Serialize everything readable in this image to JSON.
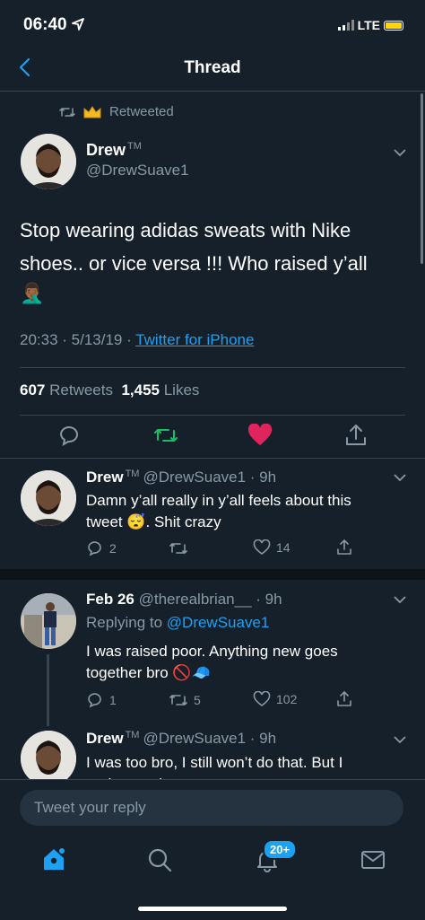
{
  "status": {
    "time": "06:40",
    "network": "LTE"
  },
  "header": {
    "title": "Thread"
  },
  "main_tweet": {
    "retweeted_label": "Retweeted",
    "name": "Drew",
    "name_suffix": "TM",
    "handle": "@DrewSuave1",
    "text_line1": "Stop wearing adidas sweats with Nike",
    "text_line2": "shoes.. or vice versa !!! Who raised y’all",
    "text_emoji": "🤦🏾‍♂️",
    "time": "20:33 · 5/13/19 · ",
    "source": "Twitter for iPhone",
    "retweets_count": "607",
    "retweets_label": "Retweets",
    "likes_count": "1,455",
    "likes_label": "Likes",
    "colors": {
      "like": "#e0245e",
      "retweet": "#17bf63"
    }
  },
  "replies": [
    {
      "name": "Drew",
      "name_suffix": "TM",
      "handle_time": "@DrewSuave1 · 9h",
      "text_line1": "Damn y’all really in y’all feels about this",
      "text_line2": "tweet 😴. Shit crazy",
      "reply_count": "2",
      "retweet_count": "",
      "like_count": "14"
    },
    {
      "name": "Feb 26",
      "handle_time": "@therealbrian__ · 9h",
      "replying_prefix": "Replying to ",
      "replying_to": "@DrewSuave1",
      "text_line1": "I was raised poor. Anything new goes",
      "text_line2": "together bro 🚫🧢",
      "reply_count": "1",
      "retweet_count": "5",
      "like_count": "102"
    },
    {
      "name": "Drew",
      "name_suffix": "TM",
      "handle_time": "@DrewSuave1 · 9h",
      "text_line1": "I was too bro, I still won’t do that. But I",
      "text_line2": "understand"
    }
  ],
  "composer": {
    "placeholder": "Tweet your reply"
  },
  "tabbar": {
    "notifications_badge": "20+"
  }
}
